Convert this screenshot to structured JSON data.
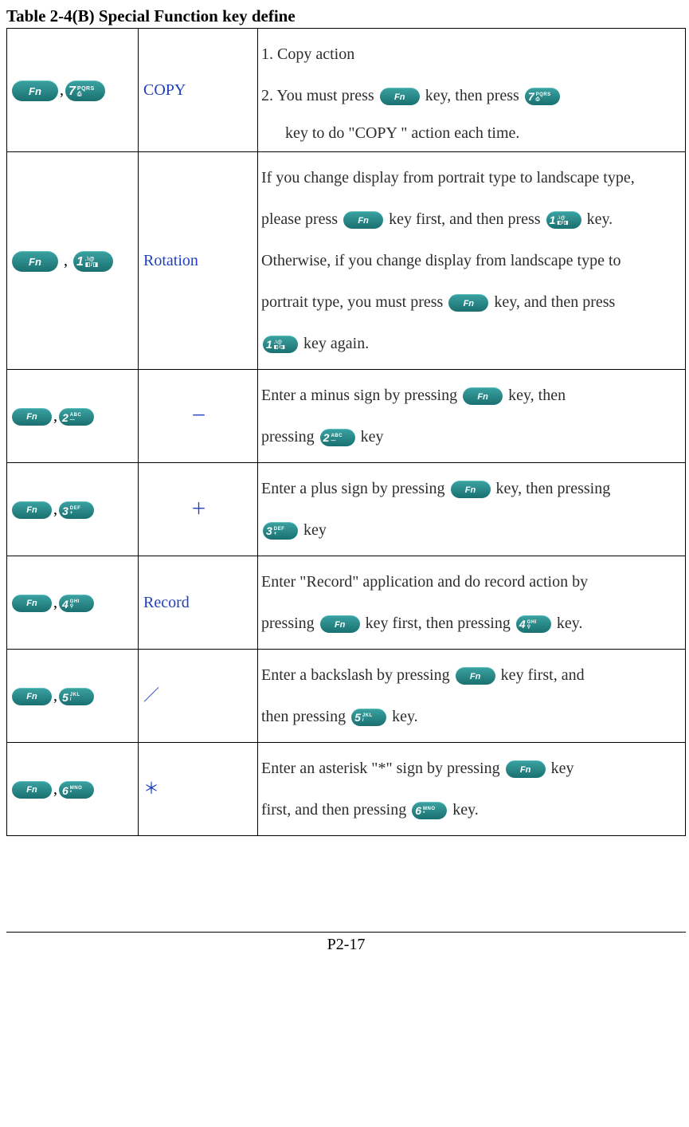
{
  "title": "Table 2-4(B) Special Function key define",
  "rows": [
    {
      "func": "COPY",
      "funcAlign": "left",
      "combo": {
        "second": {
          "dig": "7",
          "top": "PQRS",
          "bot": "⎙"
        },
        "fnSmall": false
      },
      "desc": {
        "lines": [
          "1.  Copy action",
          "2.  You must press [[FN]] key, then press [[K7]]",
          "[[INDENT]]key to do \"COPY \" action each time."
        ]
      }
    },
    {
      "func": "Rotation",
      "funcAlign": "left",
      "combo": {
        "second": {
          "dig": "1",
          "top": ".\\@",
          "bot": "◧/◨"
        },
        "fnSmall": false,
        "pad": true
      },
      "desc": {
        "lines": [
          "If you change display from portrait type to landscape type,",
          "please press [[FN]] key first, and then press [[K1]] key.",
          "Otherwise, if you change display from landscape type to",
          "portrait type, you must press [[FN]] key, and then press",
          "[[K1]] key again.",
          ""
        ]
      }
    },
    {
      "func": "－",
      "funcAlign": "center",
      "combo": {
        "second": {
          "dig": "2",
          "top": "ABC",
          "bot": "—"
        },
        "fnSmall": true
      },
      "desc": {
        "lines": [
          "Enter a minus sign by pressing [[FN]] key, then",
          "pressing [[K2]] key"
        ]
      }
    },
    {
      "func": "＋",
      "funcAlign": "center",
      "combo": {
        "second": {
          "dig": "3",
          "top": "DEF",
          "bot": "+"
        },
        "fnSmall": true
      },
      "desc": {
        "lines": [
          "Enter a plus sign by pressing [[FN]] key, then pressing",
          "[[K3]] key"
        ]
      }
    },
    {
      "func": "Record",
      "funcAlign": "left",
      "combo": {
        "second": {
          "dig": "4",
          "top": "GHI",
          "bot": "⚲"
        },
        "fnSmall": true
      },
      "desc": {
        "lines": [
          "Enter \"Record\" application and do record action by",
          "pressing [[FN]] key first, then pressing [[K4]] key."
        ]
      }
    },
    {
      "func": "／",
      "funcAlign": "left",
      "combo": {
        "second": {
          "dig": "5",
          "top": "JKL",
          "bot": "/"
        },
        "fnSmall": true
      },
      "desc": {
        "lines": [
          "Enter a backslash by pressing [[FN]] key first, and",
          "then pressing [[K5]] key."
        ]
      }
    },
    {
      "func": "＊",
      "funcAlign": "left",
      "combo": {
        "second": {
          "dig": "6",
          "top": "MNO",
          "bot": "*"
        },
        "fnSmall": true
      },
      "desc": {
        "lines": [
          "Enter an asterisk \"*\" sign by pressing [[FN]] key",
          "first, and then pressing [[K6]] key."
        ]
      }
    }
  ],
  "keydefs": {
    "K1": {
      "dig": "1",
      "top": ".\\@",
      "bot": "◧/◨"
    },
    "K2": {
      "dig": "2",
      "top": "ABC",
      "bot": "—"
    },
    "K3": {
      "dig": "3",
      "top": "DEF",
      "bot": "+"
    },
    "K4": {
      "dig": "4",
      "top": "GHI",
      "bot": "⚲"
    },
    "K5": {
      "dig": "5",
      "top": "JKL",
      "bot": "/"
    },
    "K6": {
      "dig": "6",
      "top": "MNO",
      "bot": "*"
    },
    "K7": {
      "dig": "7",
      "top": "PQRS",
      "bot": "⎙"
    }
  },
  "pagenum": "P2-17"
}
